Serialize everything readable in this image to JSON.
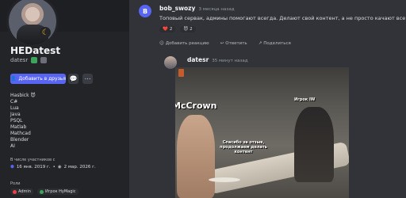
{
  "profile": {
    "display_name": "HEDatest",
    "username": "datesr",
    "add_friend_label": "Добавить в друзья",
    "about_lines": [
      "Hasbick 😈",
      "C#",
      "Lua",
      "Java",
      "PSQL",
      "Matlab",
      "Mathcad",
      "Blender",
      "AI"
    ],
    "member_since_label": "В числе участников с",
    "date_joined_discord": "16 янв. 2019 г.",
    "date_joined_server": "2 мар. 2026 г.",
    "roles_label": "Роли",
    "roles": [
      {
        "name": "Admin",
        "color": "#ed4245"
      },
      {
        "name": "Игрок HyMagic",
        "color": "#3ba55c"
      }
    ],
    "colors": {
      "brand": "#5865f2"
    }
  },
  "chat": {
    "msg1": {
      "avatar_letter": "B",
      "author": "bob_swozy",
      "time": "3 месяца назад",
      "text": "Топовый сервак, админы помогают всегда. Делают свой контент, а не просто качают все с курса. Inter-топ",
      "reactions": [
        {
          "emoji": "❤️",
          "count": "2"
        },
        {
          "emoji": "😈",
          "count": "2"
        }
      ],
      "actions": [
        {
          "icon": "add-reaction-icon",
          "label": "Добавить реакцию"
        },
        {
          "icon": "reply-icon",
          "label": "Ответить"
        },
        {
          "icon": "share-icon",
          "label": "Поделиться"
        }
      ]
    },
    "msg2": {
      "author": "datesr",
      "time": "35 минут назад",
      "image": {
        "caption_left": "McCrown",
        "caption_right": "Игрок IW",
        "caption_center": "Спасибо за отзыв, продолжаем делать контент"
      }
    }
  }
}
